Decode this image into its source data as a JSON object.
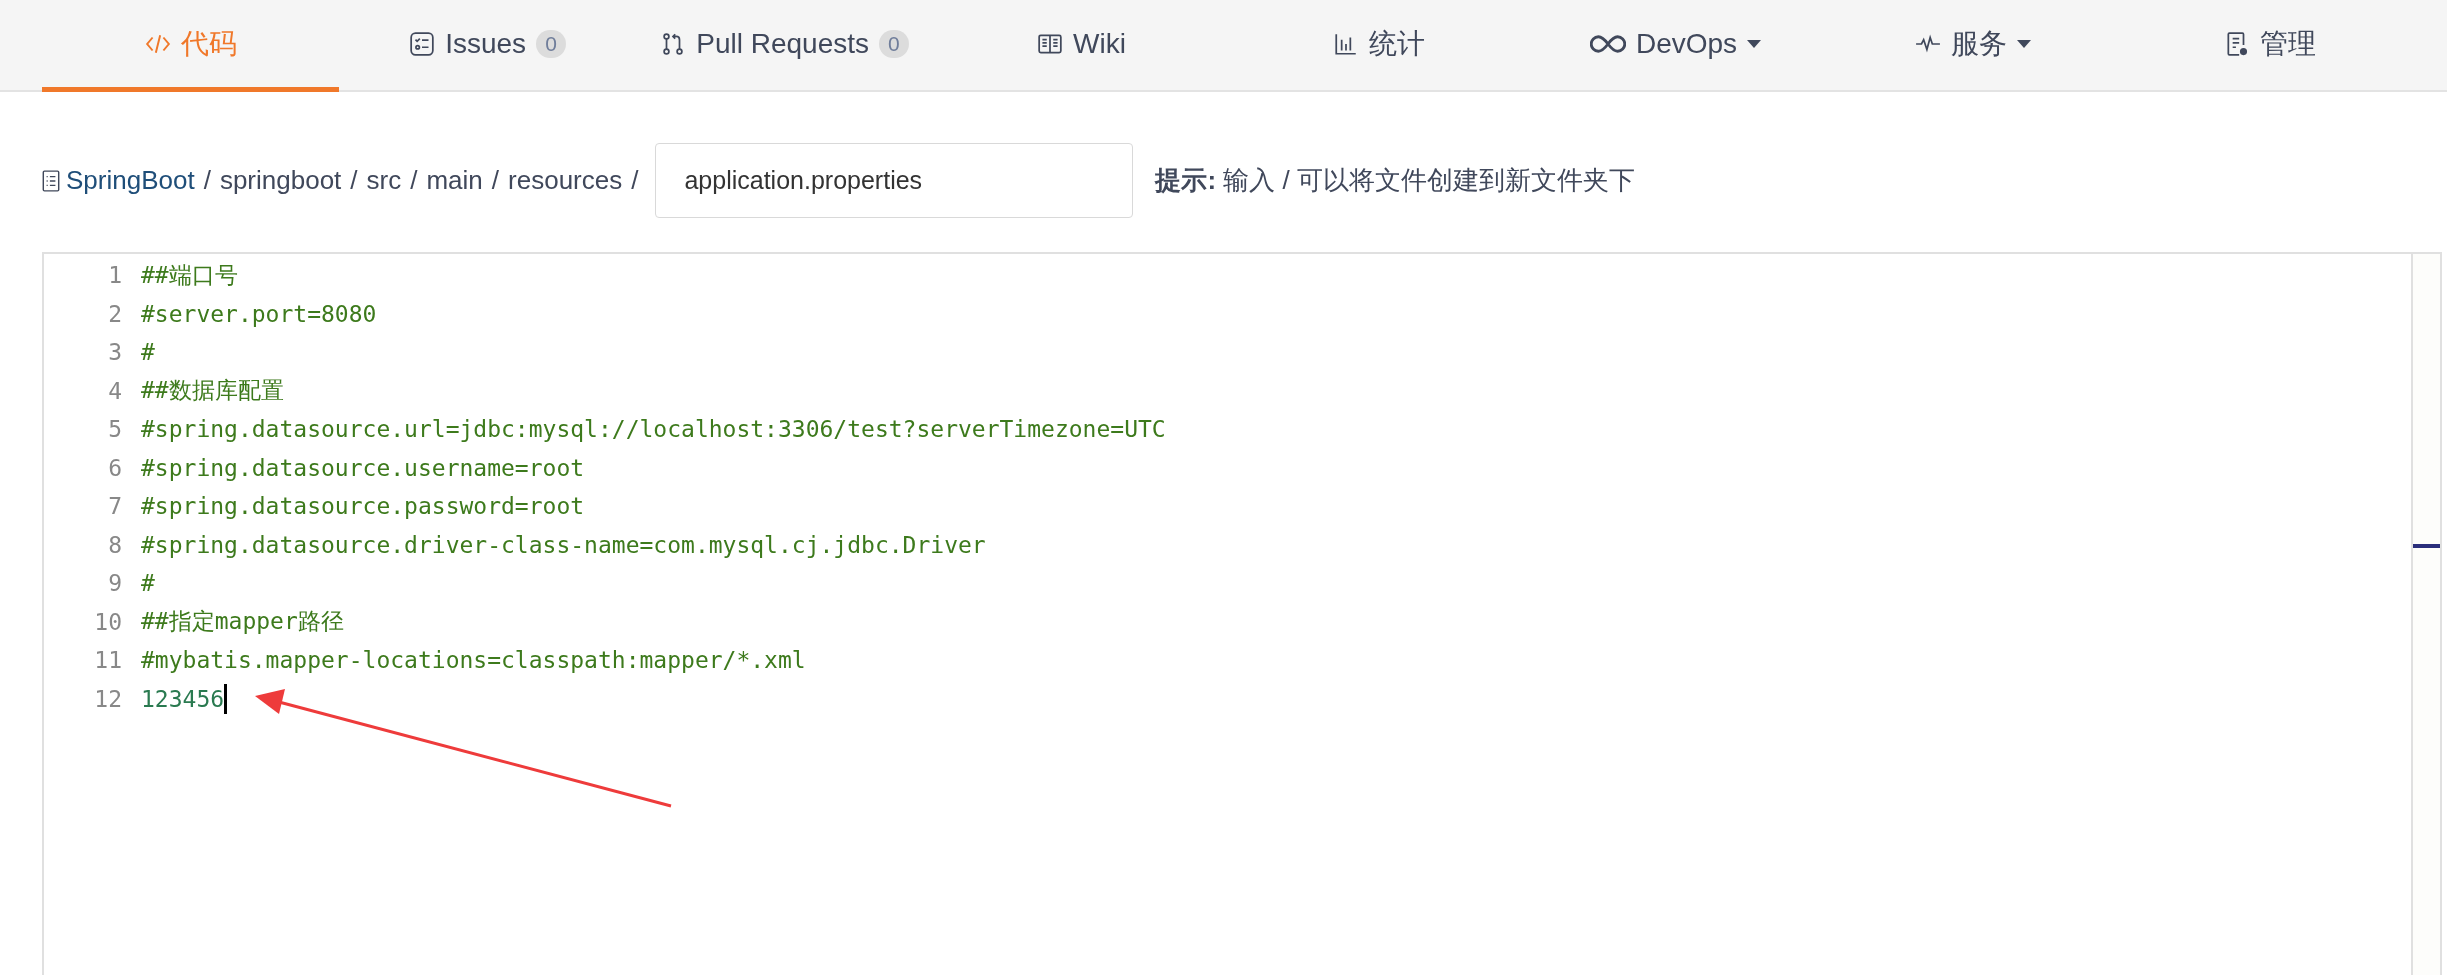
{
  "tabs": [
    {
      "label": "代码",
      "dropdown": false,
      "selected": true
    },
    {
      "label": "Issues",
      "badge": "0",
      "dropdown": false,
      "selected": false
    },
    {
      "label": "Pull Requests",
      "badge": "0",
      "dropdown": false,
      "selected": false
    },
    {
      "label": "Wiki",
      "dropdown": false,
      "selected": false
    },
    {
      "label": "统计",
      "dropdown": false,
      "selected": false
    },
    {
      "label": "DevOps",
      "dropdown": true,
      "selected": false
    },
    {
      "label": "服务",
      "dropdown": true,
      "selected": false
    },
    {
      "label": "管理",
      "dropdown": false,
      "selected": false
    }
  ],
  "path": {
    "segments": [
      "SpringBoot",
      "springboot",
      "src",
      "main",
      "resources"
    ],
    "separator": "/",
    "file_name": "application.properties",
    "hint": "**提示:** 输入 / 可以将文件创建到新文件夹下"
  },
  "editor": {
    "lines": [
      {
        "number": "1",
        "text": "##端口号",
        "kind": "comment",
        "cursor": false
      },
      {
        "number": "2",
        "text": "#server.port=8080",
        "kind": "comment",
        "cursor": false
      },
      {
        "number": "3",
        "text": "#",
        "kind": "comment",
        "cursor": false
      },
      {
        "number": "4",
        "text": "##数据库配置",
        "kind": "comment",
        "cursor": false
      },
      {
        "number": "5",
        "text": "#spring.datasource.url=jdbc:mysql://localhost:3306/test?serverTimezone=UTC",
        "kind": "comment",
        "cursor": false
      },
      {
        "number": "6",
        "text": "#spring.datasource.username=root",
        "kind": "comment",
        "cursor": false
      },
      {
        "number": "7",
        "text": "#spring.datasource.password=root",
        "kind": "comment",
        "cursor": false
      },
      {
        "number": "8",
        "text": "#spring.datasource.driver-class-name=com.mysql.cj.jdbc.Driver",
        "kind": "comment",
        "cursor": false
      },
      {
        "number": "9",
        "text": "#",
        "kind": "comment",
        "cursor": false
      },
      {
        "number": "10",
        "text": "##指定mapper路径",
        "kind": "comment",
        "cursor": false
      },
      {
        "number": "11",
        "text": "#mybatis.mapper-locations=classpath:mapper/*.xml",
        "kind": "comment",
        "cursor": false
      },
      {
        "number": "12",
        "text": "123456",
        "kind": "plain",
        "cursor": true
      }
    ]
  }
}
